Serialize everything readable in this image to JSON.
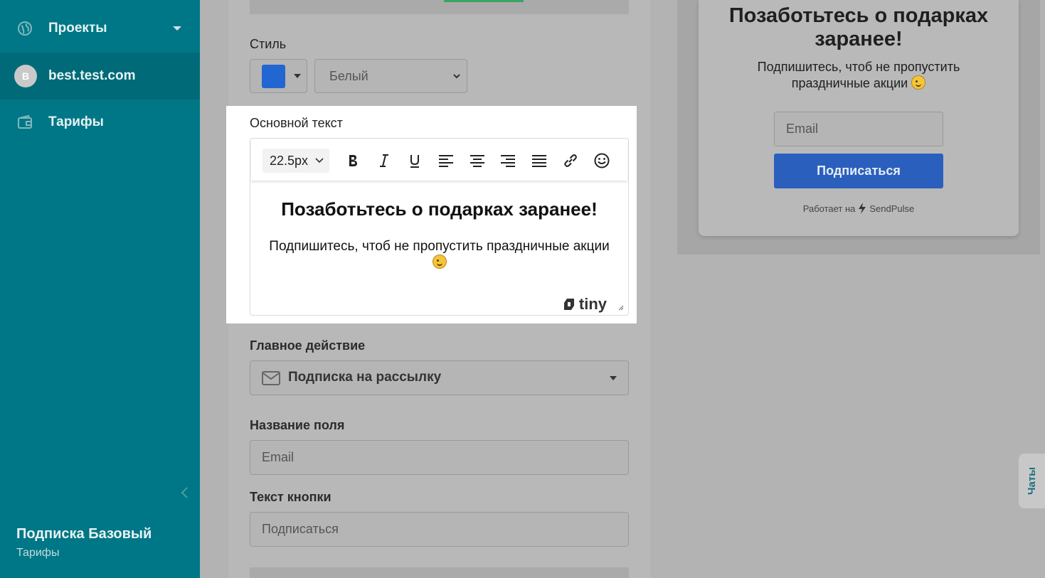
{
  "sidebar": {
    "items": [
      {
        "label": "Проекты",
        "icon": "globe-icon"
      },
      {
        "label": "best.test.com",
        "avatar": "B"
      },
      {
        "label": "Тарифы",
        "icon": "wallet-icon"
      }
    ],
    "plan_title": "Подписка Базовый",
    "plan_sub": "Тарифы"
  },
  "settings": {
    "style_label": "Стиль",
    "style_color": "#2266d1",
    "theme_value": "Белый",
    "main_text_label": "Основной текст",
    "font_size": "22.5px",
    "editor_heading": "Позаботьтесь о подарках заранее!",
    "editor_paragraph": "Подпишитесь, чтоб не пропустить праздничные акции",
    "tiny_brand": "tiny",
    "main_action_label": "Главное действие",
    "main_action_value": "Подписка на рассылку",
    "field_name_label": "Название поля",
    "field_name_value": "Email",
    "button_text_label": "Текст кнопки",
    "button_text_value": "Подписаться"
  },
  "preview": {
    "title": "Позаботьтесь о подарках заранее!",
    "subtitle": "Подпишитесь, чтоб не пропустить праздничные акции",
    "email_placeholder": "Email",
    "button_label": "Подписаться",
    "powered_prefix": "Работает на",
    "powered_brand": "SendPulse"
  },
  "chat_tab": "Чаты"
}
